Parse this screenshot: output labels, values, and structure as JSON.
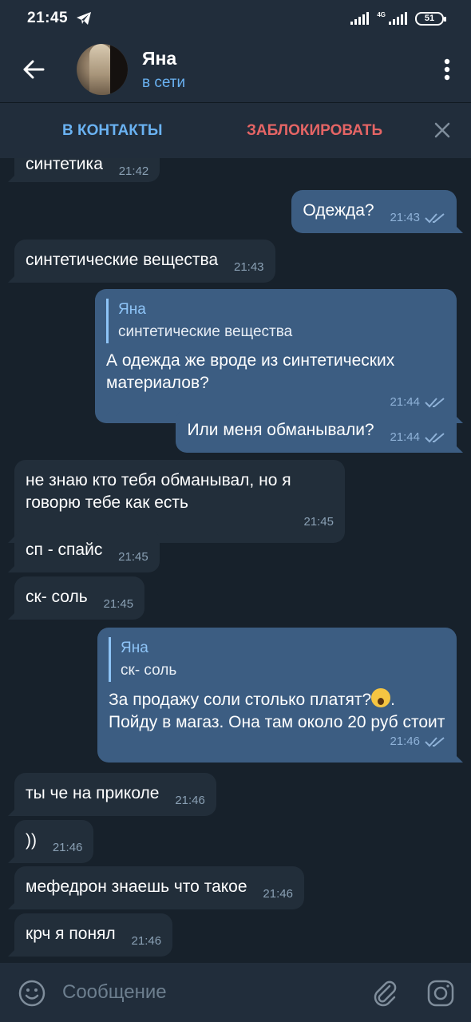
{
  "status_bar": {
    "time": "21:45",
    "network": "4G",
    "battery": "51"
  },
  "header": {
    "name": "Яна",
    "status": "в сети"
  },
  "actions": {
    "add_contact": "В КОНТАКТЫ",
    "block": "ЗАБЛОКИРОВАТЬ"
  },
  "messages": [
    {
      "dir": "in",
      "text": "синтетика",
      "time": "21:42"
    },
    {
      "dir": "out",
      "text": "Одежда?",
      "time": "21:43"
    },
    {
      "dir": "in",
      "text": "синтетические вещества",
      "time": "21:43"
    },
    {
      "dir": "out",
      "reply_name": "Яна",
      "reply_text": "синтетические вещества",
      "text": "А одежда же вроде из синтетических материалов?",
      "time": "21:44"
    },
    {
      "dir": "out",
      "text": "Или меня обманывали?",
      "time": "21:44"
    },
    {
      "dir": "in",
      "text": "не знаю кто тебя обманывал, но я говорю тебе как есть",
      "time": "21:45"
    },
    {
      "dir": "in",
      "text": "сп - спайс",
      "time": "21:45"
    },
    {
      "dir": "in",
      "text": "ск- соль",
      "time": "21:45"
    },
    {
      "dir": "out",
      "reply_name": "Яна",
      "reply_text": "ск- соль",
      "text_before_emoji": "За продажу соли столько платят?",
      "emoji": "face-screaming-in-fear",
      "text_after_emoji": ".",
      "text_cont": "Пойду в магаз. Она там около 20 руб стоит",
      "time": "21:46"
    },
    {
      "dir": "in",
      "text": "ты че на приколе",
      "time": "21:46"
    },
    {
      "dir": "in",
      "text": "))",
      "time": "21:46"
    },
    {
      "dir": "in",
      "text": "мефедрон знаешь что такое",
      "time": "21:46"
    },
    {
      "dir": "in",
      "text": "крч я понял",
      "time": "21:46"
    }
  ],
  "input": {
    "placeholder": "Сообщение"
  },
  "colors": {
    "background": "#17212b",
    "bar": "#212d3b",
    "incoming": "#222e3a",
    "outgoing": "#3c5d82",
    "accent": "#6ab2f2",
    "danger": "#e56565"
  }
}
